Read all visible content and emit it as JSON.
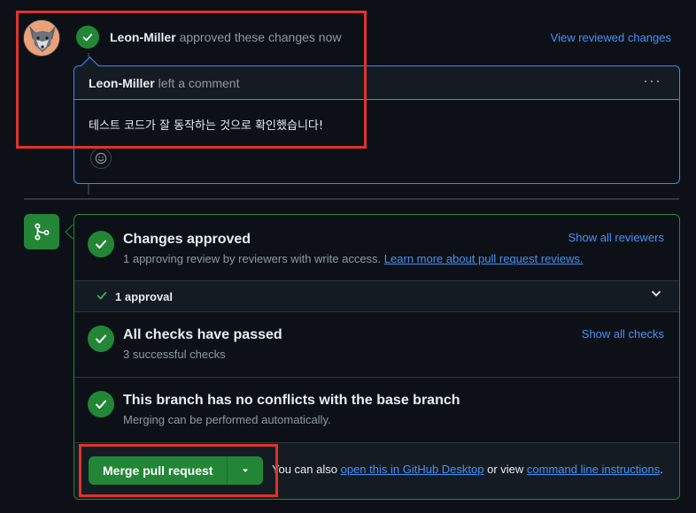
{
  "review": {
    "author": "Leon-Miller",
    "action_text": "approved these changes now",
    "view_reviewed_label": "View reviewed changes"
  },
  "comment": {
    "author": "Leon-Miller",
    "action_text": "left a comment",
    "menu_glyph": "···",
    "body": "테스트 코드가 잘 동작하는 것으로 확인했습니다!"
  },
  "merge_box": {
    "approved": {
      "title": "Changes approved",
      "subtitle_prefix": "1 approving review by reviewers with write access.",
      "learn_more_link": "Learn more about pull request reviews.",
      "show_all_reviewers": "Show all reviewers"
    },
    "approval_count": {
      "label": "1 approval"
    },
    "checks": {
      "title": "All checks have passed",
      "subtitle": "3 successful checks",
      "show_all_checks": "Show all checks"
    },
    "conflicts": {
      "title": "This branch has no conflicts with the base branch",
      "subtitle": "Merging can be performed automatically."
    },
    "merge": {
      "button_label": "Merge pull request",
      "help_prefix": "You can also",
      "desktop_link": "open this in GitHub Desktop",
      "help_middle": "or view",
      "cli_link": "command line instructions",
      "help_suffix": "."
    }
  },
  "colors": {
    "background": "#0d1117",
    "accent_green": "#238636",
    "link_blue": "#4493f8",
    "highlight_red": "#e0322b",
    "comment_border": "#388bfd"
  },
  "icons": [
    "fox-avatar",
    "check-icon",
    "kebab-icon",
    "smiley-icon",
    "git-merge-icon",
    "chevron-down-icon",
    "triangle-down-icon"
  ]
}
